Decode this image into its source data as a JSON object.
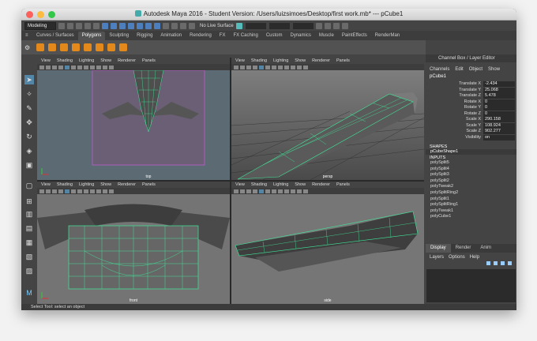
{
  "window": {
    "title": "Autodesk Maya 2016 - Student Version: /Users/luizsimoes/Desktop/first work.mb*  ---  pCube1"
  },
  "status_line": {
    "mode": "Modeling",
    "live_surface": "No Live Surface"
  },
  "shelf_tabs": [
    "Curves / Surfaces",
    "Polygons",
    "Sculpting",
    "Rigging",
    "Animation",
    "Rendering",
    "FX",
    "FX Caching",
    "Custom",
    "Dynamics",
    "Muscle",
    "PaintEffects",
    "RenderMan"
  ],
  "active_shelf_tab": "Polygons",
  "viewport_menu": [
    "View",
    "Shading",
    "Lighting",
    "Show",
    "Renderer",
    "Panels"
  ],
  "viewports": {
    "top": "top",
    "persp": "persp",
    "front": "front",
    "side": "side"
  },
  "channel_box": {
    "header": "Channel Box / Layer Editor",
    "menu": [
      "Channels",
      "Edit",
      "Object",
      "Show"
    ],
    "object": "pCube1",
    "attributes": [
      {
        "name": "Translate X",
        "value": "-2.434"
      },
      {
        "name": "Translate Y",
        "value": "25.068"
      },
      {
        "name": "Translate Z",
        "value": "5.478"
      },
      {
        "name": "Rotate X",
        "value": "0"
      },
      {
        "name": "Rotate Y",
        "value": "0"
      },
      {
        "name": "Rotate Z",
        "value": "0"
      },
      {
        "name": "Scale X",
        "value": "290.158"
      },
      {
        "name": "Scale Y",
        "value": "108.924"
      },
      {
        "name": "Scale Z",
        "value": "902.277"
      },
      {
        "name": "Visibility",
        "value": "on"
      }
    ],
    "shapes_label": "SHAPES",
    "shapes": [
      "pCubeShape1"
    ],
    "inputs_label": "INPUTS",
    "inputs": [
      "polySplit5",
      "polySplit4",
      "polySplit3",
      "polySplit2",
      "polyTweak2",
      "polySplitRing2",
      "polySplit1",
      "polySplitRing1",
      "polyTweak1",
      "polyCube1"
    ]
  },
  "layer_editor": {
    "tabs": [
      "Display",
      "Render",
      "Anim"
    ],
    "active_tab": "Display",
    "menu": [
      "Layers",
      "Options",
      "Help"
    ]
  },
  "help_line": "Select Tool: select an object",
  "colors": {
    "wire": "#3fe89a",
    "selection": "#5285a6",
    "shelf_icon": "#e3891b"
  }
}
